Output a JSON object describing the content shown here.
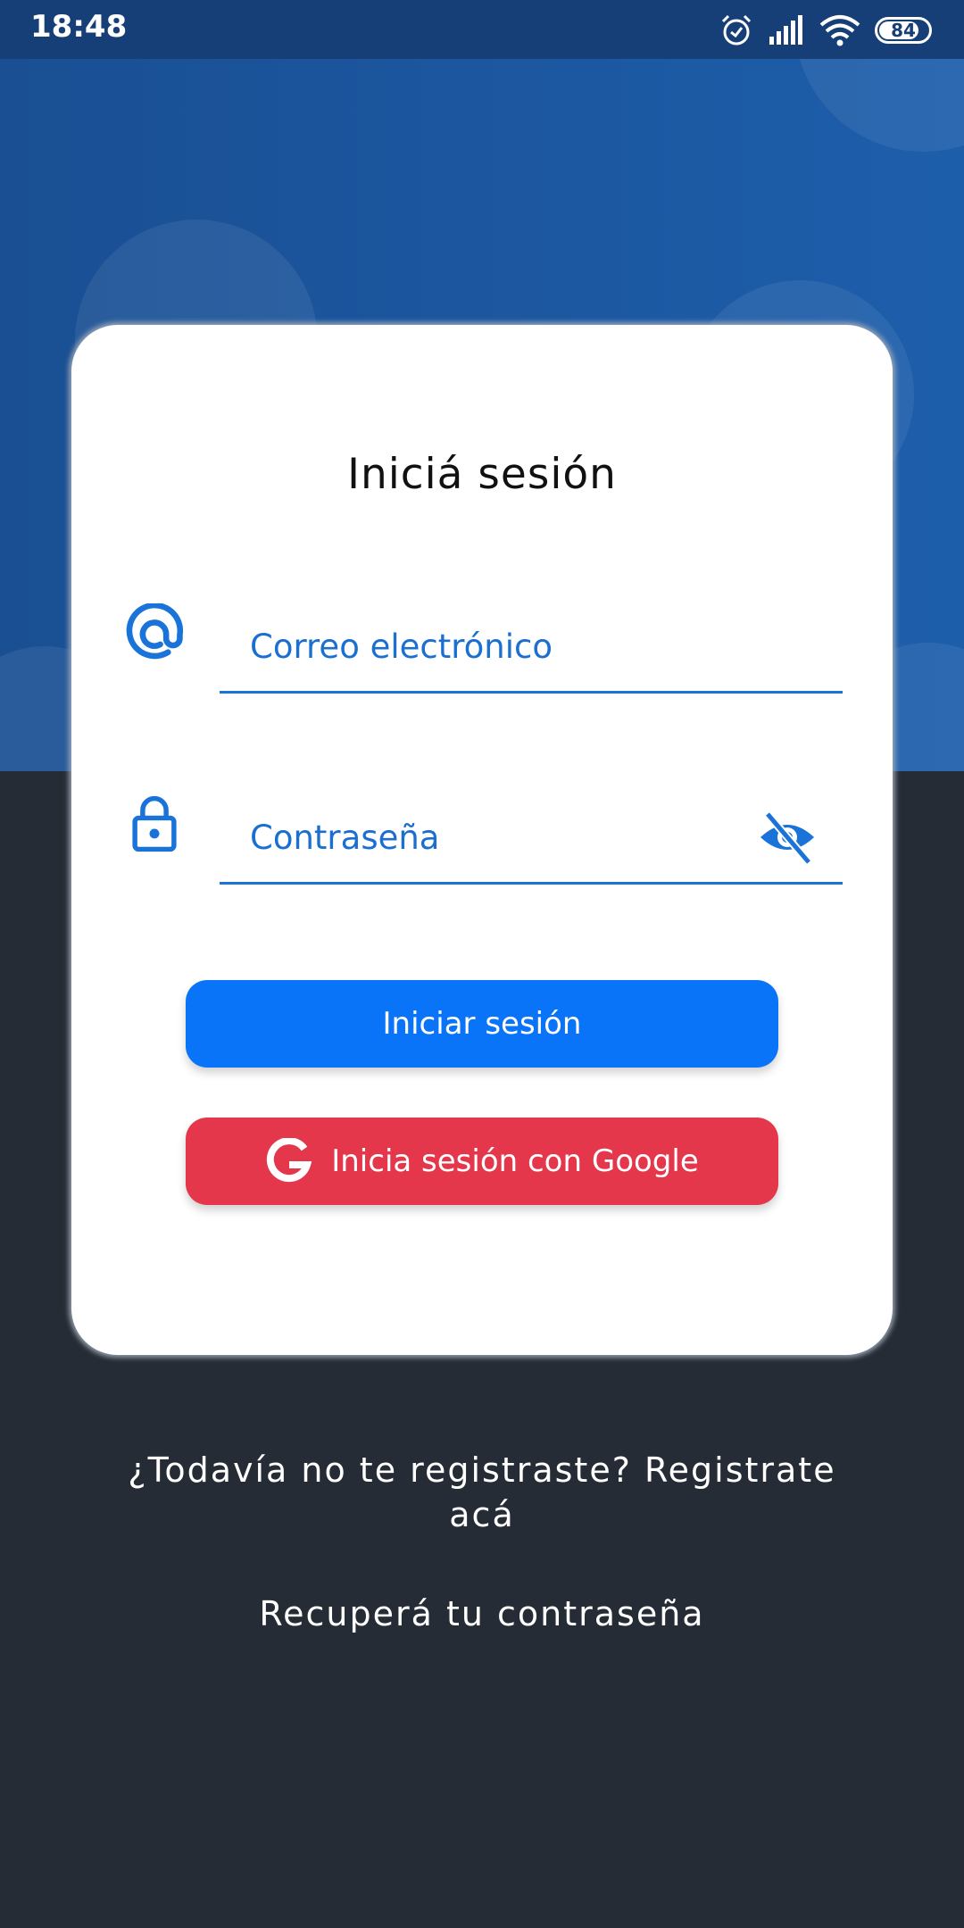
{
  "status_bar": {
    "time": "18:48",
    "battery": "84",
    "icons": [
      "alarm-icon",
      "signal-icon",
      "wifi-icon",
      "battery-icon"
    ]
  },
  "login": {
    "title": "Iniciá sesión",
    "email_placeholder": "Correo electrónico",
    "password_placeholder": "Contraseña",
    "login_button": "Iniciar sesión",
    "google_button": "Inicia sesión con Google"
  },
  "links": {
    "register": "¿Todavía no te registraste? Registrate acá",
    "recover": "Recuperá tu contraseña"
  },
  "colors": {
    "header_blue": "#1d5eab",
    "background_dark": "#262c35",
    "primary_button": "#0a74f9",
    "google_button": "#e5374c",
    "field_accent": "#1a73d8"
  }
}
